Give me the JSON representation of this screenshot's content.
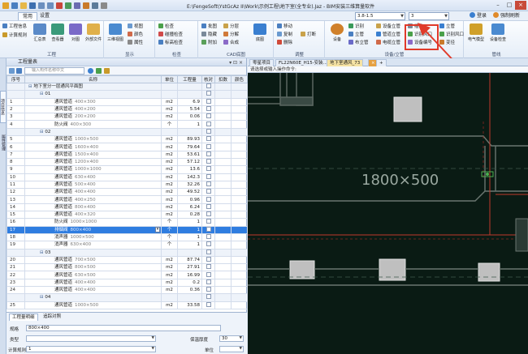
{
  "app": {
    "title": "E:\\FengeSoft\\YstGcAz II\\Work\\示例工程\\地下室(全专业).Jaz - BIM安装三维算量软件",
    "combo1": "3.8-1.5",
    "combo2": "3",
    "login": "登录",
    "updates": "强制刷新"
  },
  "menu": {
    "tabs": [
      "常用",
      "设置"
    ],
    "active_tab": "常用"
  },
  "ribbon": {
    "groups": [
      {
        "label": "工程",
        "buttons": [
          "工程信息",
          "计算规则",
          "汇总表",
          "查看器",
          "对图",
          "外部文件"
        ]
      },
      {
        "label": "显示",
        "buttons": [
          "三维视图",
          "视图",
          "颜色",
          "属性"
        ]
      },
      {
        "label": "检查",
        "buttons": [
          "检查",
          "碰撞检查",
          "标高检查",
          "管道检查"
        ]
      },
      {
        "label": "CAD底图",
        "buttons": [
          "批图",
          "分层",
          "隐藏",
          "分解",
          "附加",
          "合成",
          "底图"
        ]
      },
      {
        "label": "调整",
        "buttons": [
          "移动",
          "复制",
          "删除",
          "打断"
        ]
      },
      {
        "label": "设备/立管",
        "buttons": [
          "设备",
          "识别",
          "立管",
          "布立管",
          "设备立管",
          "管道立管",
          "电缆立管",
          "插件",
          "识别风口",
          "设备编号",
          "立管",
          "识别风口",
          "变径"
        ]
      },
      {
        "label": "管线",
        "buttons": [
          "电气模型",
          "设备检查"
        ]
      }
    ],
    "highlight_button": "识别风口"
  },
  "left_tabs": [
    "项目信息",
    "属性管理"
  ],
  "panel": {
    "title": "工程量表",
    "search_placeholder": "输入构件名称中文",
    "columns": [
      "序号",
      "名称",
      "单位",
      "工程量",
      "核对",
      "扣数",
      "颜色"
    ],
    "rows": [
      {
        "idx": "",
        "name": "地下室分一层通风平面图",
        "unit": "",
        "qty": "",
        "group": true,
        "level": 0
      },
      {
        "idx": "",
        "name": "01",
        "unit": "",
        "qty": "",
        "group": true,
        "level": 1
      },
      {
        "idx": "1",
        "name": "通风管道",
        "spec": "400×300",
        "unit": "m2",
        "qty": "6.9"
      },
      {
        "idx": "2",
        "name": "通风管道",
        "spec": "400×200",
        "unit": "m2",
        "qty": "5.54"
      },
      {
        "idx": "3",
        "name": "通风管道",
        "spec": "200×200",
        "unit": "m2",
        "qty": "0.06"
      },
      {
        "idx": "4",
        "name": "防火阀",
        "spec": "400×300",
        "unit": "个",
        "qty": "1"
      },
      {
        "idx": "",
        "name": "02",
        "unit": "",
        "qty": "",
        "group": true,
        "level": 1
      },
      {
        "idx": "5",
        "name": "通风管道",
        "spec": "1000×500",
        "unit": "m2",
        "qty": "89.93"
      },
      {
        "idx": "6",
        "name": "通风管道",
        "spec": "1600×400",
        "unit": "m2",
        "qty": "79.64"
      },
      {
        "idx": "7",
        "name": "通风管道",
        "spec": "1500×400",
        "unit": "m2",
        "qty": "53.61"
      },
      {
        "idx": "8",
        "name": "通风管道",
        "spec": "1200×400",
        "unit": "m2",
        "qty": "57.12"
      },
      {
        "idx": "9",
        "name": "通风管道",
        "spec": "1000×1000",
        "unit": "m2",
        "qty": "13.6"
      },
      {
        "idx": "10",
        "name": "通风管道",
        "spec": "630×400",
        "unit": "m2",
        "qty": "142.3"
      },
      {
        "idx": "11",
        "name": "通风管道",
        "spec": "500×400",
        "unit": "m2",
        "qty": "32.26"
      },
      {
        "idx": "12",
        "name": "通风管道",
        "spec": "400×400",
        "unit": "m2",
        "qty": "49.52"
      },
      {
        "idx": "13",
        "name": "通风管道",
        "spec": "400×250",
        "unit": "m2",
        "qty": "0.96"
      },
      {
        "idx": "14",
        "name": "通风管道",
        "spec": "800×400",
        "unit": "m2",
        "qty": "6.24"
      },
      {
        "idx": "15",
        "name": "通风管道",
        "spec": "400×320",
        "unit": "m2",
        "qty": "0.28"
      },
      {
        "idx": "16",
        "name": "防火阀",
        "spec": "1000×1000",
        "unit": "个",
        "qty": "1"
      },
      {
        "idx": "17",
        "name": "排烟阀",
        "spec": "800×400",
        "unit": "个",
        "qty": "1",
        "selected": true
      },
      {
        "idx": "18",
        "name": "消声器",
        "spec": "1000×500",
        "unit": "个",
        "qty": "1"
      },
      {
        "idx": "19",
        "name": "消声器",
        "spec": "630×400",
        "unit": "个",
        "qty": "1"
      },
      {
        "idx": "",
        "name": "03",
        "unit": "",
        "qty": "",
        "group": true,
        "level": 1
      },
      {
        "idx": "20",
        "name": "通风管道",
        "spec": "700×500",
        "unit": "m2",
        "qty": "87.74"
      },
      {
        "idx": "21",
        "name": "通风管道",
        "spec": "800×500",
        "unit": "m2",
        "qty": "27.91"
      },
      {
        "idx": "22",
        "name": "通风管道",
        "spec": "630×500",
        "unit": "m2",
        "qty": "16.99"
      },
      {
        "idx": "23",
        "name": "通风管道",
        "spec": "400×400",
        "unit": "m2",
        "qty": "0.2"
      },
      {
        "idx": "24",
        "name": "通风管道",
        "spec": "400×400",
        "unit": "m2",
        "qty": "0.36"
      },
      {
        "idx": "",
        "name": "04",
        "unit": "",
        "qty": "",
        "group": true,
        "level": 1
      },
      {
        "idx": "25",
        "name": "通风管道",
        "spec": "1000×500",
        "unit": "m2",
        "qty": "33.58"
      }
    ]
  },
  "bottom": {
    "tabs": [
      "工程量明细",
      "追踪对照"
    ],
    "spec_label": "规格",
    "spec_value": "800×400",
    "type_label": "类型",
    "rule_label": "计算规则",
    "rule_value": "1",
    "precision_label": "保温厚度",
    "precision_value": "30",
    "unit_label": "单位"
  },
  "drawing": {
    "tabs": [
      "零星项目",
      "FL22N60E_H15-安装...",
      "地下室通风_73"
    ],
    "active_tab": "地下室通风_73",
    "command_prompt": "请选择或输入操作命令:",
    "dimension_label": "1800×500"
  },
  "colors": {
    "canvas_bg": "#0a1b14",
    "duct_outline": "#5a6660",
    "red_line": "#c0392b",
    "gray_block": "#bfbfbf",
    "highlight": "#e03a2a",
    "selection": "#2f7de0"
  }
}
